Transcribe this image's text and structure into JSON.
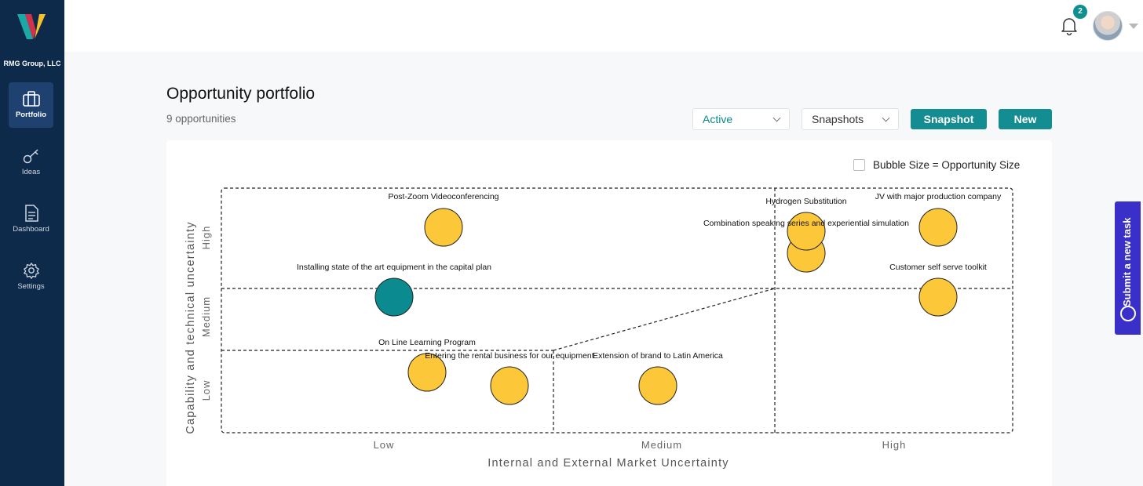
{
  "org": {
    "name": "RMG Group, LLC"
  },
  "sidebar": {
    "items": [
      {
        "label": "Portfolio",
        "icon": "briefcase-icon",
        "active": true
      },
      {
        "label": "Ideas",
        "icon": "key-icon",
        "active": false
      },
      {
        "label": "Dashboard",
        "icon": "document-icon",
        "active": false
      },
      {
        "label": "Settings",
        "icon": "gear-icon",
        "active": false
      }
    ]
  },
  "header": {
    "notification_count": "2"
  },
  "page": {
    "title": "Opportunity portfolio",
    "subtitle": "9 opportunities",
    "status_filter": "Active",
    "snapshots_filter": "Snapshots",
    "snapshot_button": "Snapshot",
    "new_button": "New",
    "bubble_toggle_label": "Bubble Size = Opportunity Size"
  },
  "side_tab": {
    "label": "Submit a new task"
  },
  "colors": {
    "sidebar": "#0e2a4a",
    "accent": "#138d91",
    "bubble": "#fcc83a",
    "selected_bubble": "#0b8a8f",
    "task_tab": "#3a2fc8"
  },
  "chart_data": {
    "type": "scatter",
    "xlabel": "Internal and External Market Uncertainty",
    "ylabel": "Capability and technical uncertainty",
    "x_categories": [
      "Low",
      "Medium",
      "High"
    ],
    "y_categories": [
      "Low",
      "Medium",
      "High"
    ],
    "points": [
      {
        "label": "Post-Zoom Videoconferencing",
        "x": "Low",
        "y": "High",
        "selected": false
      },
      {
        "label": "Installing state of the art equipment in the capital plan",
        "x": "Low",
        "y": "Medium",
        "selected": true
      },
      {
        "label": "On Line Learning Program",
        "x": "Low",
        "y": "Low",
        "selected": false
      },
      {
        "label": "Entering the rental business for our equipment",
        "x": "Low",
        "y": "Low",
        "selected": false
      },
      {
        "label": "Extension of brand to Latin America",
        "x": "Medium",
        "y": "Low",
        "selected": false
      },
      {
        "label": "Hydrogen Substitution",
        "x": "High",
        "y": "High",
        "selected": false
      },
      {
        "label": "Combination speaking series and experiential simulation",
        "x": "High",
        "y": "High",
        "selected": false
      },
      {
        "label": "JV with major production company",
        "x": "High",
        "y": "High",
        "selected": false
      },
      {
        "label": "Customer self serve toolkit",
        "x": "High",
        "y": "Medium",
        "selected": false
      }
    ]
  }
}
